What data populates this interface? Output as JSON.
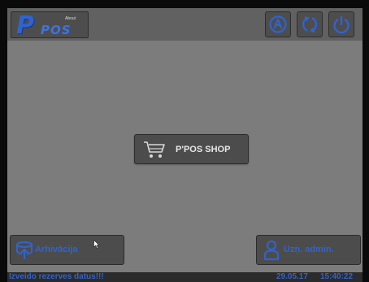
{
  "header": {
    "logo": {
      "mark": "P",
      "name": "POS",
      "about": "About"
    },
    "buttons": [
      {
        "icon": "admin-a-icon"
      },
      {
        "icon": "refresh-icon"
      },
      {
        "icon": "power-icon"
      }
    ]
  },
  "main": {
    "shop_button": {
      "label": "P'POS SHOP",
      "icon": "cart-icon"
    }
  },
  "bottom": {
    "archive_button": {
      "label": "Arhivācija",
      "icon": "database-upload-icon"
    },
    "admin_button": {
      "label": "Uzņ. admin.",
      "icon": "user-icon"
    }
  },
  "status": {
    "message": "Izveido rezerves datus!!!",
    "date": "29.05.17",
    "time": "15:40:22"
  },
  "colors": {
    "accent": "#2f63d0",
    "background": "#7c7c7c",
    "header": "#616161",
    "button": "#4c4c4c",
    "status_bar": "#2b2b2b"
  }
}
